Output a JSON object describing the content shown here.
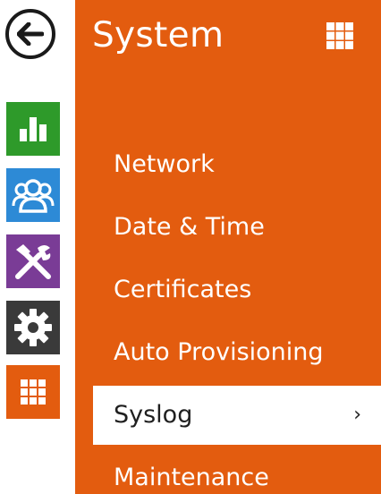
{
  "panel": {
    "title": "System",
    "color": "#e35c0f"
  },
  "rail": {
    "items": [
      {
        "name": "status",
        "icon": "bar-chart-icon",
        "color": "#2e9a2a"
      },
      {
        "name": "directory",
        "icon": "users-icon",
        "color": "#2d8ad6"
      },
      {
        "name": "hardware",
        "icon": "tools-icon",
        "color": "#7a3c96"
      },
      {
        "name": "services",
        "icon": "gear-icon",
        "color": "#3a3a3a"
      },
      {
        "name": "system",
        "icon": "grid-icon",
        "color": "#e35c0f"
      }
    ]
  },
  "menu": {
    "items": [
      {
        "label": "Network"
      },
      {
        "label": "Date & Time"
      },
      {
        "label": "Certificates"
      },
      {
        "label": "Auto Provisioning"
      },
      {
        "label": "Syslog",
        "active": true,
        "chevron": "›"
      },
      {
        "label": "Maintenance"
      }
    ]
  }
}
